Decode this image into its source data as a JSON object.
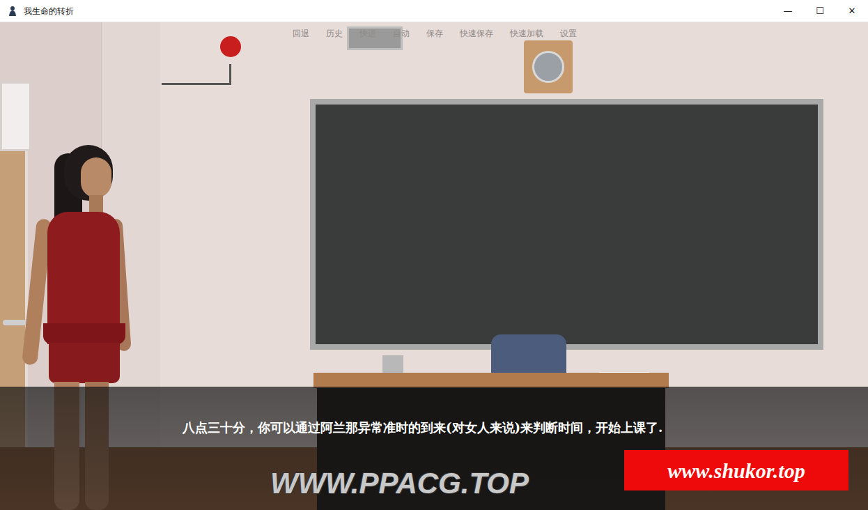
{
  "window": {
    "title": "我生命的转折",
    "controls": [
      "—",
      "☐",
      "✕"
    ]
  },
  "quick_menu": [
    "回退",
    "历史",
    "快进",
    "自动",
    "保存",
    "快速保存",
    "快速加载",
    "设置"
  ],
  "dialogue": {
    "text": "八点三十分，你可以通过阿兰那异常准时的到来(对女人来说)来判断时间，开始上课了."
  },
  "watermarks": [
    "WWW.PPACG.TOP",
    "www.shukor.top"
  ]
}
